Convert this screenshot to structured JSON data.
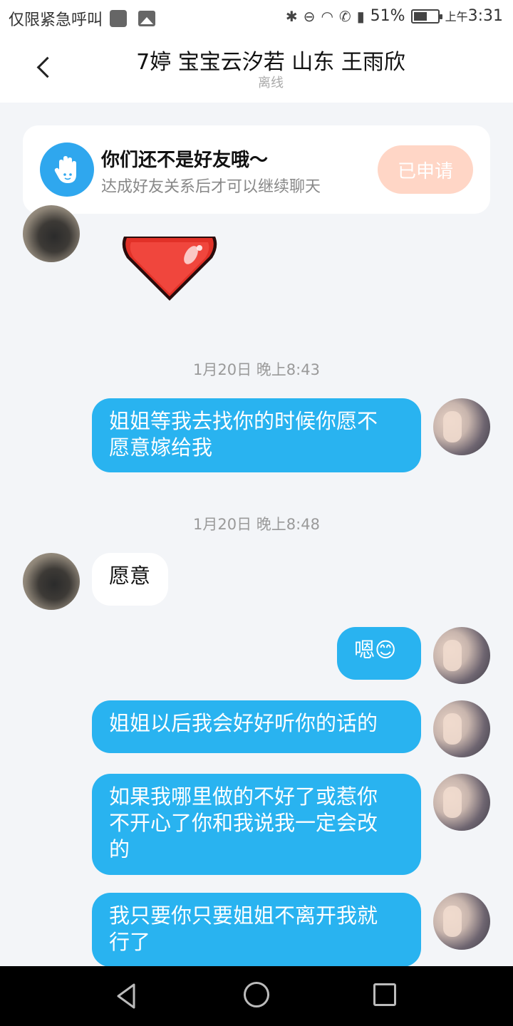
{
  "status_bar": {
    "left_text": "仅限紧急呼叫",
    "battery_percent": "51%",
    "time_prefix": "上午",
    "time": "3:31"
  },
  "header": {
    "title": "7婷 宝宝云汐若 山东 王雨欣",
    "status": "离线"
  },
  "friend_card": {
    "title": "你们还不是好友哦～",
    "subtitle": "达成好友关系后才可以继续聊天",
    "button_label": "已申请"
  },
  "messages": [
    {
      "timestamp": "1月20日 晚上8:43"
    },
    {
      "text": "姐姐等我去找你的时候你愿不愿意嫁给我",
      "line1": "姐姐等我去找你的时候你愿不",
      "line2": "愿意嫁给我"
    },
    {
      "timestamp": "1月20日 晚上8:48"
    },
    {
      "text": "愿意"
    },
    {
      "text": "嗯😊"
    },
    {
      "text": "姐姐以后我会好好听你的话的"
    },
    {
      "line1": "如果我哪里做的不好了或惹你",
      "line2": "不开心了你和我说我一定会改",
      "line3": "的"
    },
    {
      "line1": "我只要你只要姐姐不离开我就",
      "line2": "行了"
    }
  ],
  "colors": {
    "bubble_self": "#29b3f0",
    "bubble_other": "#ffffff",
    "applied_button": "#ffd6c6",
    "hand_icon_bg": "#2fa7ee"
  }
}
